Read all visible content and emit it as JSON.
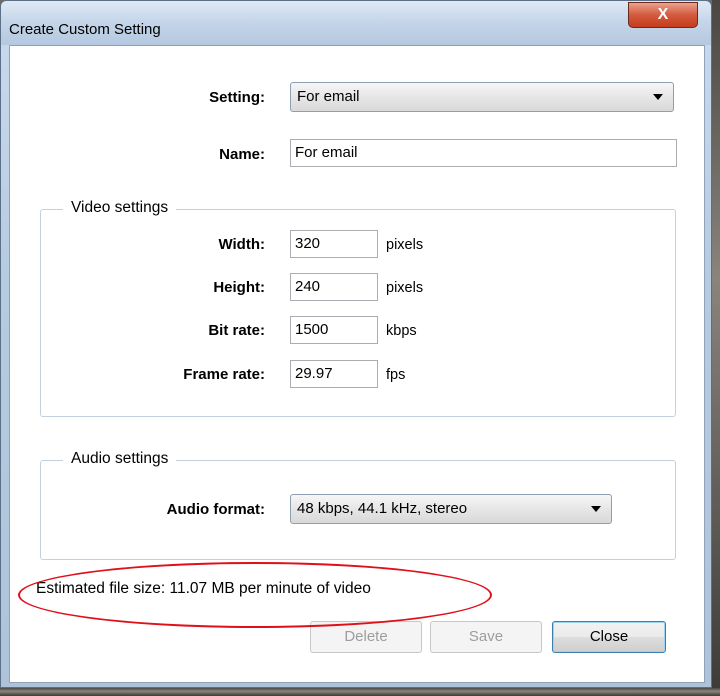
{
  "window": {
    "title": "Create Custom Setting",
    "close_glyph": "X"
  },
  "setting": {
    "label": "Setting:",
    "value": "For email"
  },
  "name": {
    "label": "Name:",
    "value": "For email"
  },
  "video": {
    "group_title": "Video settings",
    "width": {
      "label": "Width:",
      "value": "320",
      "unit": "pixels"
    },
    "height": {
      "label": "Height:",
      "value": "240",
      "unit": "pixels"
    },
    "bitrate": {
      "label": "Bit rate:",
      "value": "1500",
      "unit": "kbps"
    },
    "framerate": {
      "label": "Frame rate:",
      "value": "29.97",
      "unit": "fps"
    }
  },
  "audio": {
    "group_title": "Audio settings",
    "format": {
      "label": "Audio format:",
      "value": "48 kbps, 44.1 kHz, stereo"
    }
  },
  "estimate": "Estimated file size: 11.07 MB per minute of video",
  "buttons": {
    "delete": "Delete",
    "save": "Save",
    "close": "Close"
  },
  "colors": {
    "annotation": "#e0101a",
    "close_button": "#c43c1d"
  }
}
